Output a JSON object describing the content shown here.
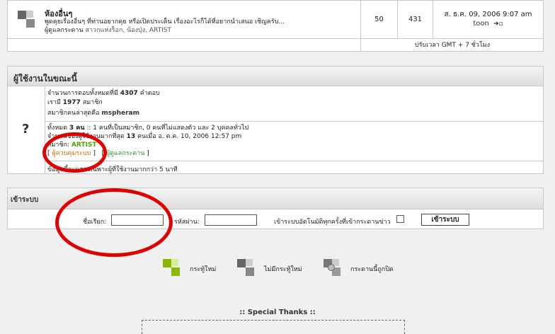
{
  "forum_row": {
    "title": "ห้องอื่นๆ",
    "description": "พูดคุยเรื่องอื่นๆ ที่ท่านอยากคุย หรือเปิดประเด็น เรื่องอะไรก็ได้ที่อยากนำเสนอ เชิญครับ...",
    "moderators_label": "ผู้ดูแลกระดาน",
    "moderators": "สาวกแห่งร็อก, น้องปุ่ง, ARTIST",
    "topics": "50",
    "posts": "431",
    "last_post_date": "ส. ธ.ค. 09, 2006 9:07 am",
    "last_post_user": "toon"
  },
  "timezone_note": "ปรับเวลา GMT + 7 ชั่วโมง",
  "whos_online": {
    "header": "ผู้ใช้งานในขณะนี้",
    "total_posts_prefix": "จำนวนการตอบทั้งหมดที่มี",
    "total_posts": "4307",
    "total_posts_suffix": "คำตอบ",
    "members_prefix": "เรามี",
    "members": "1977",
    "members_suffix": "สมาชิก",
    "newest_prefix": "สมาชิกคนล่าสุดคือ",
    "newest_member": "mspheram",
    "online_prefix": "ทั้งหมด",
    "online_count": "3 คน",
    "online_detail": ":: 1 คนที่เป็นสมาชิก, 0 คนที่ไม่แสดงตัว และ 2 บุคคลทั่วไป",
    "record_prefix": "จำนวนของผู้ใช้งานมากที่สุด",
    "record_count": "13",
    "record_suffix": "คนเมื่อ อ. ต.ค. 10, 2006 12:57 pm",
    "members_online_label": "สมาชิก:",
    "online_member": "ARTIST",
    "legend_admin": "ผู้ควบคุมระบบ",
    "legend_mod": "ผู้ดูแลกระดาน",
    "footer_note": "ข้อมูลนี้จะแสดงเฉพาะผู้ที่ใช้งานมากกว่า 5 นาที",
    "question_mark": "?"
  },
  "login": {
    "header": "เข้าระบบ",
    "username_label": "ชื่อเรียก:",
    "password_label": "รหัสผ่าน:",
    "autologin_label": "เข้าระบบอัตโนมัติทุกครั้งที่เข้ากระดานข่าว",
    "submit_label": "เข้าระบบ"
  },
  "legend": {
    "new_posts": "กระทู้ใหม่",
    "no_new_posts": "ไม่มีกระทู้ใหม่",
    "locked": "กระดานนี้ถูกปิด"
  },
  "special_thanks": ":: Special Thanks ::",
  "colors": {
    "annotation_red": "#e10000",
    "artist_green": "#5a9a00",
    "admin_orange": "#c87000",
    "mod_green": "#2f8a2f",
    "new_icon_green": "#8ab800"
  }
}
